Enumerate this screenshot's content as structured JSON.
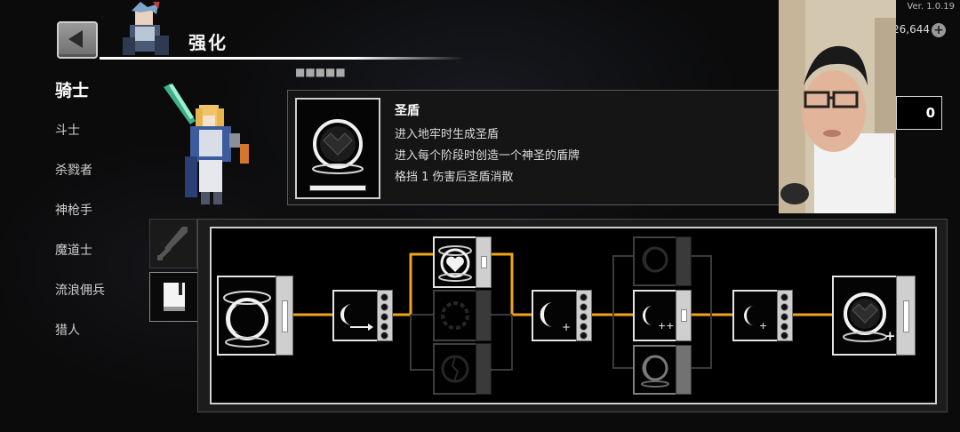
{
  "version": "Ver. 1.0.19",
  "header": {
    "title": "强化",
    "back_label": "back"
  },
  "currency": {
    "value": "26,644"
  },
  "classes": [
    {
      "label": "骑士",
      "active": true
    },
    {
      "label": "斗士"
    },
    {
      "label": "杀戮者"
    },
    {
      "label": "神枪手"
    },
    {
      "label": "魔道士"
    },
    {
      "label": "流浪佣兵"
    },
    {
      "label": "猎人"
    }
  ],
  "skill": {
    "name": "圣盾",
    "lines": [
      "进入地牢时生成圣盾",
      "进入每个阶段时创造一个神圣的盾牌",
      "格挡 1 伤害后圣盾消散"
    ]
  },
  "counter": {
    "value": "0"
  },
  "tabs": [
    {
      "name": "weapon",
      "icon": "sword-icon",
      "active": false
    },
    {
      "name": "skills",
      "icon": "book-icon",
      "active": true
    }
  ],
  "colors": {
    "connector": "#f0a419",
    "panel_border": "#cfcfcf"
  }
}
